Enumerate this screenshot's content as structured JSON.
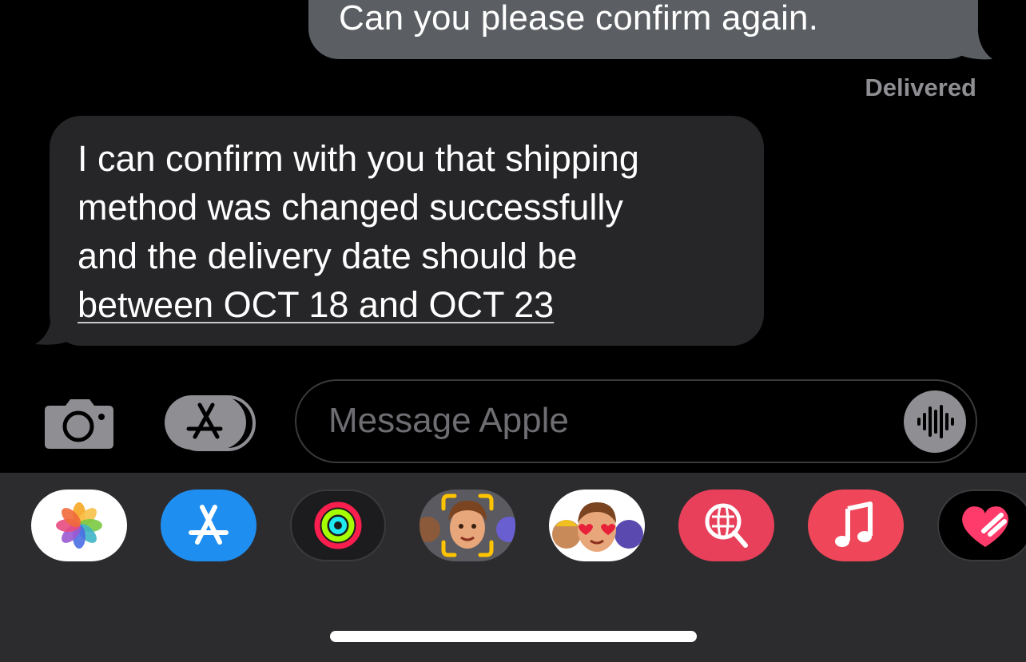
{
  "conversation": {
    "sent_message": "Can you please confirm again.",
    "sent_status": "Delivered",
    "received_message": {
      "lines": [
        "I can confirm with you that shipping",
        "method was changed successfully",
        "and the delivery date should be"
      ],
      "link_text": "between OCT 18 and OCT 23"
    }
  },
  "composer": {
    "placeholder": "Message Apple",
    "camera_icon": "camera-icon",
    "apps_icon": "app-store-icon",
    "voice_icon": "waveform-icon"
  },
  "app_drawer": {
    "apps": [
      {
        "name": "photos",
        "icon": "photos-icon"
      },
      {
        "name": "app-store",
        "icon": "app-store-icon"
      },
      {
        "name": "fitness",
        "icon": "activity-rings-icon"
      },
      {
        "name": "memoji",
        "icon": "memoji-icon"
      },
      {
        "name": "memoji-stickers",
        "icon": "memoji-stickers-icon"
      },
      {
        "name": "images-search",
        "icon": "globe-search-icon"
      },
      {
        "name": "music",
        "icon": "music-note-icon"
      },
      {
        "name": "digital-touch",
        "icon": "heart-icon"
      }
    ]
  },
  "colors": {
    "background": "#000000",
    "sent_bubble": "#5b5e63",
    "received_bubble": "#262628",
    "drawer": "#2c2c2e",
    "secondary_text": "#8e8e93"
  }
}
